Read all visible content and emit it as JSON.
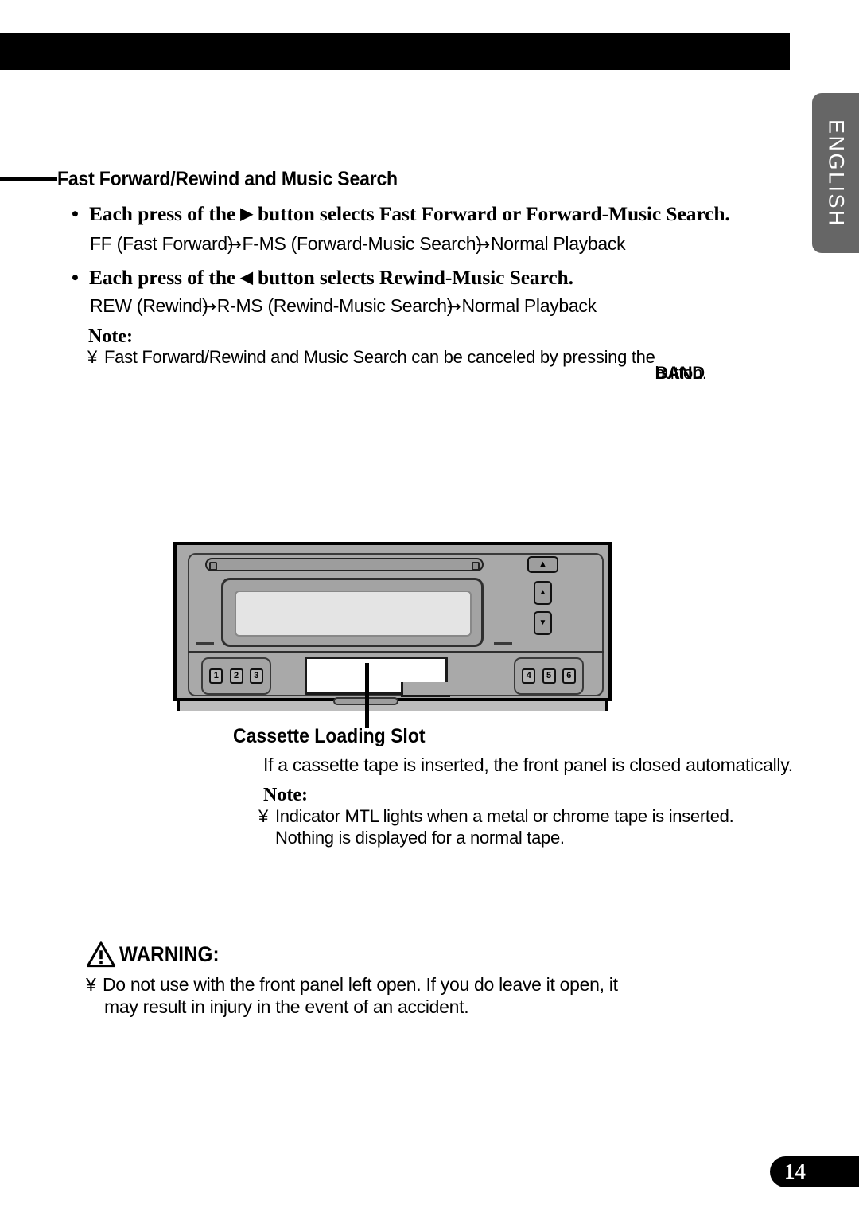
{
  "page": {
    "number": "14",
    "language_tab": "ENGLISH"
  },
  "section": {
    "heading": "Fast Forward/Rewind and Music Search"
  },
  "bullets": [
    {
      "prefix": "Each press of the",
      "glyph": "▶",
      "suffix": "button selects Fast Forward or Forward-Music Search.",
      "flow": {
        "step1": "FF (Fast Forward)",
        "arrow1": "→",
        "step2": "F-MS (Forward-Music Search)",
        "arrow2": "→",
        "step3": "Normal Playback"
      }
    },
    {
      "prefix": "Each press of the",
      "glyph": "◀",
      "suffix": "button selects Rewind-Music Search.",
      "flow": {
        "step1": "REW (Rewind)",
        "arrow1": "→",
        "step2": "R-MS (Rewind-Music Search)",
        "arrow2": "→",
        "step3": "Normal Playback"
      }
    }
  ],
  "note_one": {
    "label": "Note:",
    "bullet": "¥",
    "text": "Fast Forward/Rewind and Music Search can be canceled by pressing the",
    "overlap_bold": "BAND",
    "overlap_plain": "button."
  },
  "illustration": {
    "eject_icon": "▲",
    "up_icon": "▲",
    "down_icon": "▼",
    "preset_keys_left": [
      "1",
      "2",
      "3"
    ],
    "preset_keys_right": [
      "4",
      "5",
      "6"
    ],
    "lcd_text": ""
  },
  "cassette_section": {
    "caption": "Cassette Loading Slot",
    "body": "If a cassette tape is inserted, the front panel is closed automatically.",
    "note_label": "Note:",
    "note_bullet": "¥",
    "note_line1": "Indicator  MTL  lights when a metal or chrome tape is inserted.",
    "note_line2": "Nothing is displayed for a normal tape."
  },
  "warning": {
    "title": "WARNING:",
    "bullet": "¥",
    "line1": "Do not use with the front panel left open. If you do leave it open, it",
    "line2": "may result in injury in the event of an accident."
  },
  "colors": {
    "bar_black": "#000000",
    "tab_gray": "#666666",
    "chassis_gray": "#a9a9a9",
    "lcd_gray": "#e4e4e4"
  }
}
